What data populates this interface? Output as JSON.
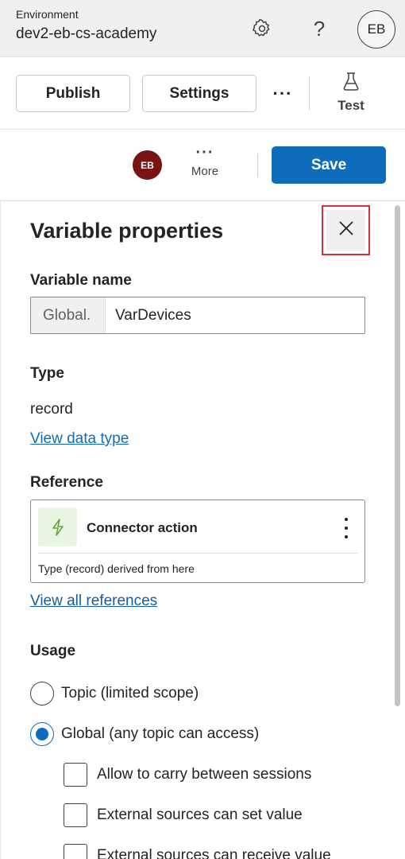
{
  "environment": {
    "label": "Environment",
    "name": "dev2-eb-cs-academy",
    "avatar_initials": "EB",
    "icons": [
      "gear-icon",
      "help-icon"
    ]
  },
  "toolbar": {
    "publish_label": "Publish",
    "settings_label": "Settings",
    "more_label": "···",
    "test_label": "Test"
  },
  "subbar": {
    "avatar_initials": "EB",
    "avatar_color": "#7a1313",
    "more_dots": "···",
    "more_label": "More",
    "save_label": "Save",
    "accent_color": "#0f6cbd"
  },
  "panel": {
    "title": "Variable properties",
    "variable_name": {
      "label": "Variable name",
      "prefix": "Global.",
      "value": "VarDevices"
    },
    "type": {
      "label": "Type",
      "value": "record",
      "link": "View data type"
    },
    "reference": {
      "label": "Reference",
      "card_title": "Connector action",
      "card_note": "Type (record) derived from here",
      "link": "View all references"
    },
    "usage": {
      "label": "Usage",
      "options": [
        {
          "label": "Topic (limited scope)",
          "checked": false
        },
        {
          "label": "Global (any topic can access)",
          "checked": true
        }
      ],
      "checkboxes": [
        {
          "label": "Allow to carry between sessions",
          "checked": false
        },
        {
          "label": "External sources can set value",
          "checked": false
        },
        {
          "label": "External sources can receive value",
          "checked": false
        }
      ]
    }
  }
}
